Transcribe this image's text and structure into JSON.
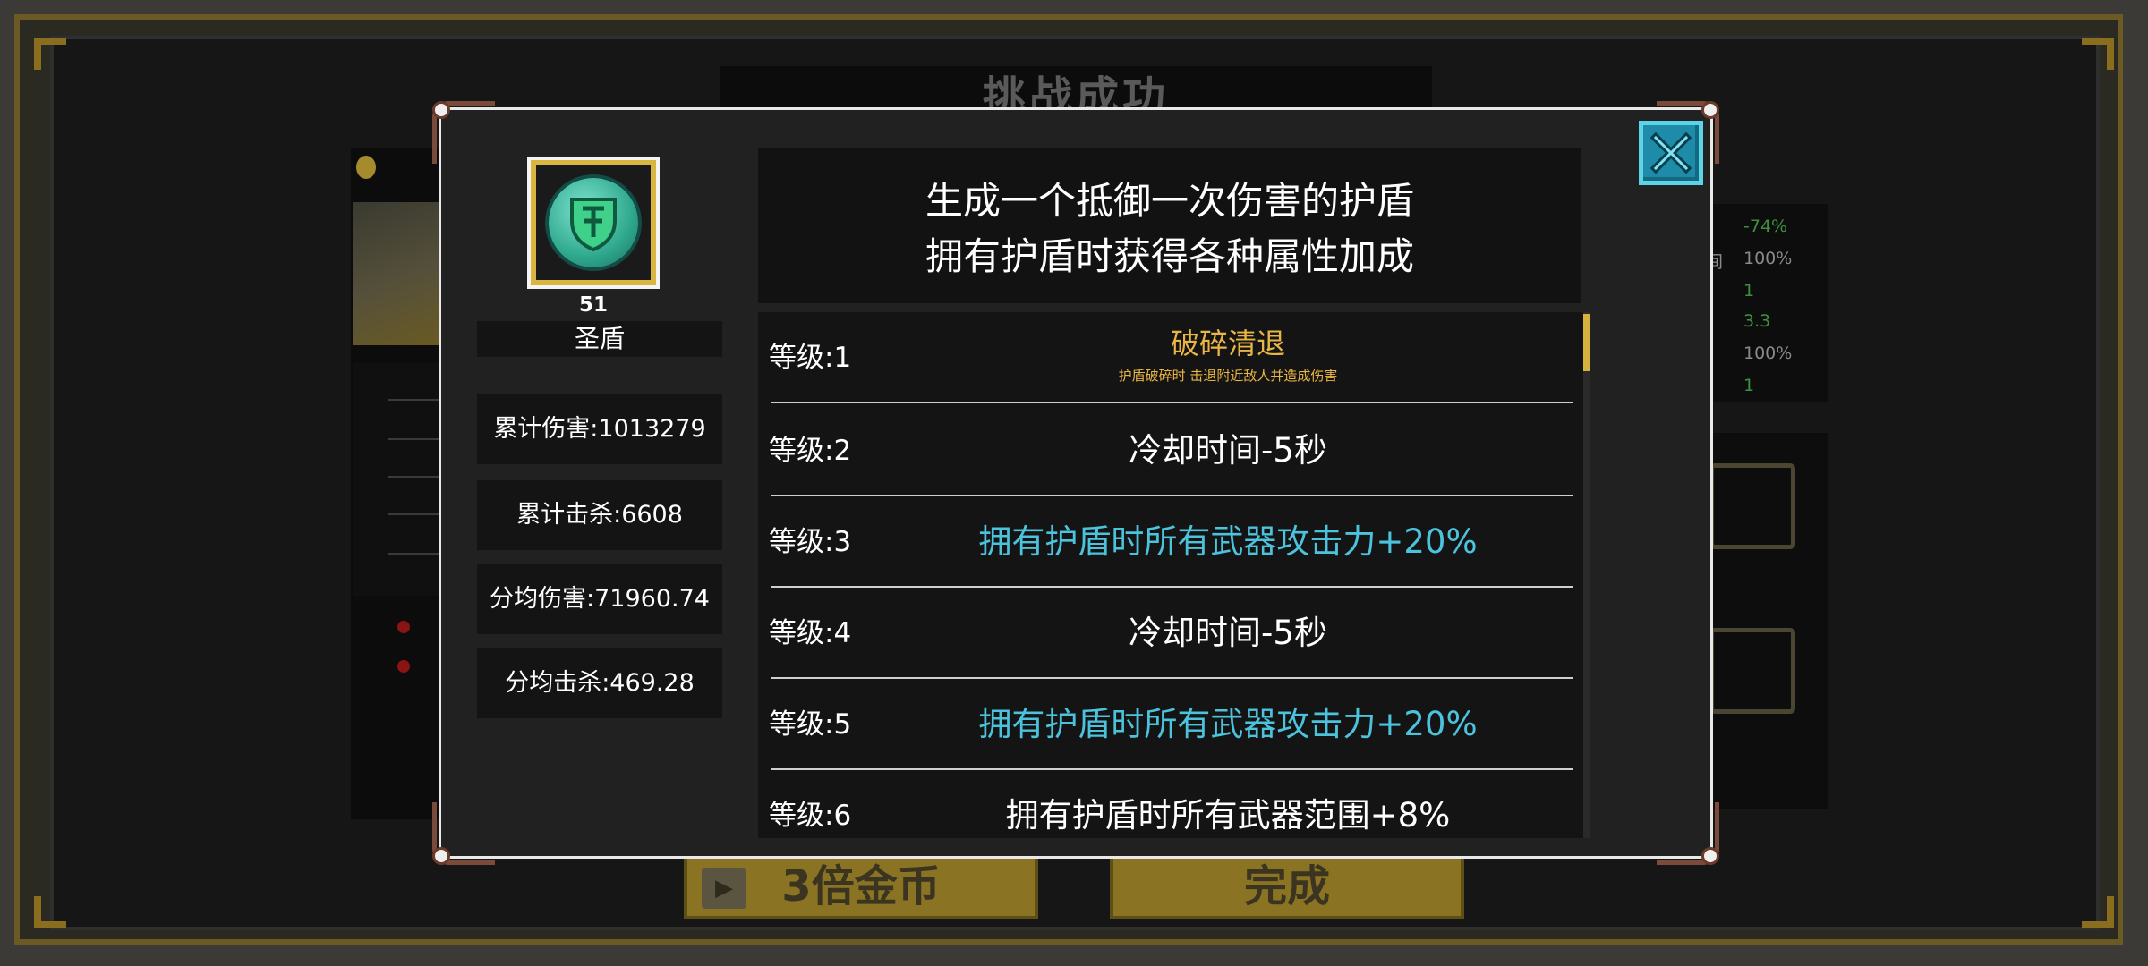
{
  "background": {
    "title": "挑战成功",
    "stats": [
      "-74%",
      "100%",
      "1",
      "3.3",
      "100%",
      "1"
    ],
    "stat_label": "间",
    "buttons": {
      "triple_coins": "3倍金币",
      "done": "完成"
    }
  },
  "item": {
    "level": "51",
    "name": "圣盾",
    "icon": "shield-emblem-icon"
  },
  "stats": {
    "total_damage": "累计伤害:1013279",
    "total_kills": "累计击杀:6608",
    "avg_damage": "分均伤害:71960.74",
    "avg_kills": "分均击杀:469.28"
  },
  "description": {
    "line1": "生成一个抵御一次伤害的护盾",
    "line2": "拥有护盾时获得各种属性加成"
  },
  "levels": [
    {
      "label": "等级:1",
      "text": "破碎清退",
      "subtext": "护盾破碎时 击退附近敌人并造成伤害",
      "color": "#e9b543"
    },
    {
      "label": "等级:2",
      "text": "冷却时间-5秒",
      "color": "#ffffff"
    },
    {
      "label": "等级:3",
      "text": "拥有护盾时所有武器攻击力+20%",
      "color": "#4cc3dd"
    },
    {
      "label": "等级:4",
      "text": "冷却时间-5秒",
      "color": "#ffffff"
    },
    {
      "label": "等级:5",
      "text": "拥有护盾时所有武器攻击力+20%",
      "color": "#4cc3dd"
    },
    {
      "label": "等级:6",
      "text": "拥有护盾时所有武器范围+8%",
      "color": "#ffffff"
    }
  ],
  "close_icon": "close-icon",
  "colors": {
    "accent_gold": "#e9b543",
    "accent_cyan": "#4cc3dd",
    "close_button": "#1e8ca8"
  }
}
